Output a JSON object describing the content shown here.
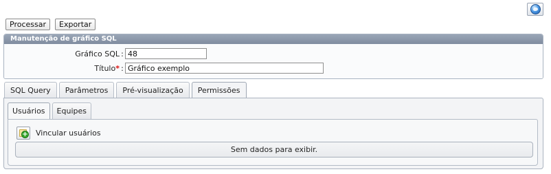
{
  "header": {
    "help_icon": "globe-help-icon"
  },
  "toolbar": {
    "process_label": "Processar",
    "export_label": "Exportar"
  },
  "panel": {
    "title": "Manutenção de gráfico SQL",
    "fields": {
      "chart_id": {
        "label": "Gráfico SQL",
        "value": "48"
      },
      "title": {
        "label": "Título",
        "required_mark": "*",
        "value": "Gráfico exemplo"
      }
    },
    "colon": ":"
  },
  "tabs": [
    {
      "label": "SQL Query"
    },
    {
      "label": "Parâmetros"
    },
    {
      "label": "Pré-visualização"
    },
    {
      "label": "Permissões",
      "active": true
    }
  ],
  "subtabs": [
    {
      "label": "Usuários",
      "active": true
    },
    {
      "label": "Equipes"
    }
  ],
  "permissions": {
    "link_users_label": "Vincular usuários",
    "link_users_icon": "add-user-icon",
    "empty_message": "Sem dados para exibir."
  }
}
